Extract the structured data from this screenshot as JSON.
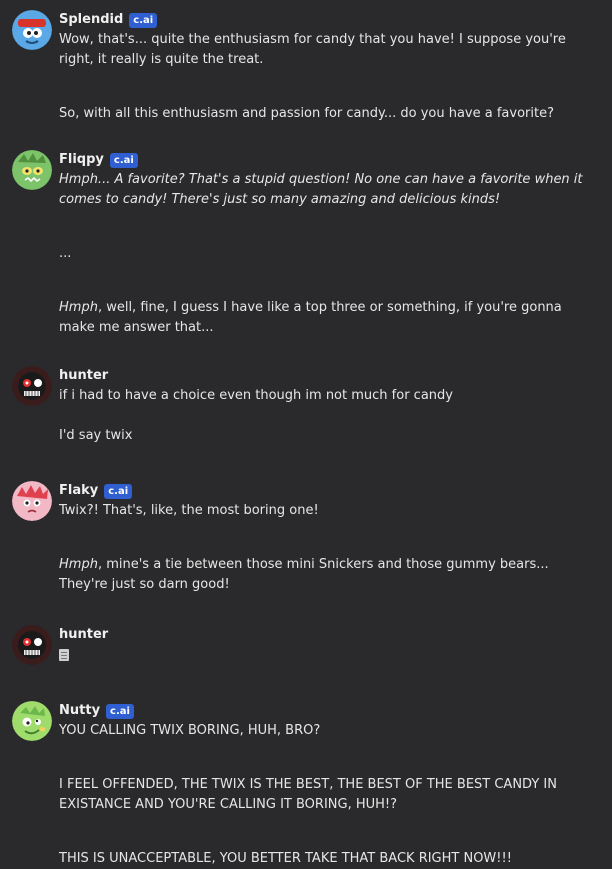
{
  "badge_label": "c.ai",
  "messages": [
    {
      "author": "Splendid",
      "is_ai": true,
      "paragraphs": [
        {
          "text": "Wow, that's... quite the enthusiasm for candy that you have! I suppose you're right, it really is quite the treat."
        },
        {
          "text": "So, with all this enthusiasm and passion for candy... do you have a favorite?"
        }
      ]
    },
    {
      "author": "Fliqpy",
      "is_ai": true,
      "paragraphs": [
        {
          "text": "Hmph... A favorite? That's a stupid question! No one can have a favorite when it comes to candy! There's just so many amazing and delicious kinds!",
          "italic": true
        },
        {
          "text": "..."
        },
        {
          "italic_prefix": "Hmph",
          "text": ", well, fine, I guess I have like a top three or something, if you're gonna make me answer that..."
        }
      ]
    },
    {
      "author": "hunter",
      "is_ai": false,
      "paragraphs": [
        {
          "text": "if i had to have a choice even though im not much for candy"
        },
        {
          "text": "I'd say twix"
        }
      ]
    },
    {
      "author": "Flaky",
      "is_ai": true,
      "paragraphs": [
        {
          "text": "Twix?! That's, like, the most boring one!"
        },
        {
          "italic_prefix": "Hmph",
          "text": ", mine's a tie between those mini Snickers and those gummy bears... They're just so darn good!"
        }
      ]
    },
    {
      "author": "hunter",
      "is_ai": false,
      "paragraphs": []
    },
    {
      "author": "Nutty",
      "is_ai": true,
      "paragraphs": [
        {
          "text": "YOU CALLING TWIX BORING, HUH, BRO?"
        },
        {
          "text": "I FEEL OFFENDED, THE TWIX IS THE BEST, THE BEST OF THE BEST CANDY IN EXISTANCE AND YOU'RE CALLING IT BORING, HUH!?"
        },
        {
          "text": "THIS IS UNACCEPTABLE, YOU BETTER TAKE THAT BACK RIGHT NOW!!!"
        }
      ]
    }
  ],
  "colors": {
    "background": "#2a2a2c",
    "badge": "#2f5fd0",
    "text": "#e6e6e6"
  }
}
